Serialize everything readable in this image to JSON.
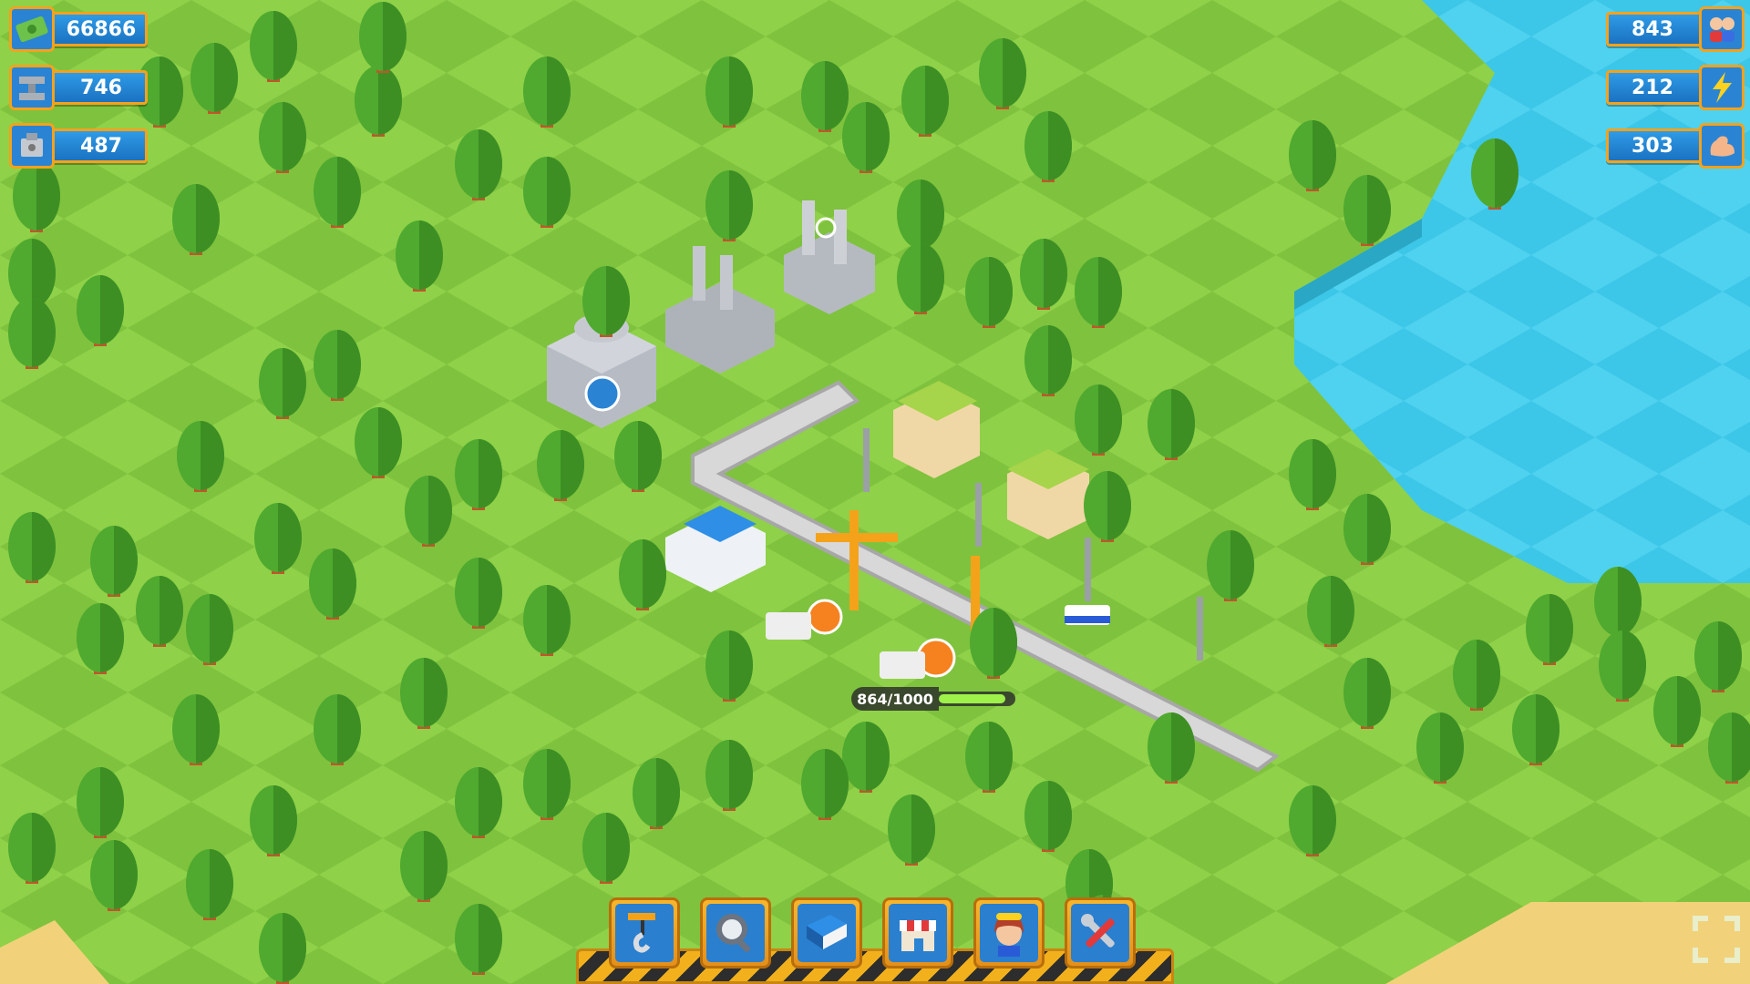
{
  "resources": {
    "money": {
      "value": "66866",
      "icon": "money-icon"
    },
    "steel": {
      "value": "746",
      "icon": "steel-icon"
    },
    "machines": {
      "value": "487",
      "icon": "machine-icon"
    },
    "population": {
      "value": "843",
      "icon": "people-icon"
    },
    "energy": {
      "value": "212",
      "icon": "lightning-icon"
    },
    "workforce": {
      "value": "303",
      "icon": "muscle-icon"
    }
  },
  "construction": {
    "progress_text": "864/1000",
    "progress": 0.864
  },
  "toolbar": {
    "buttons": [
      {
        "name": "build-crane-button",
        "icon": "crane-hook-icon"
      },
      {
        "name": "search-button",
        "icon": "magnifier-icon"
      },
      {
        "name": "book-button",
        "icon": "book-icon"
      },
      {
        "name": "shop-button",
        "icon": "shop-icon"
      },
      {
        "name": "advisor-button",
        "icon": "advisor-avatar-icon"
      },
      {
        "name": "tools-button",
        "icon": "wrench-screwdriver-icon"
      }
    ]
  },
  "colors": {
    "grass": "#8fd148",
    "grass_dark": "#7cbf3a",
    "water": "#3cc6e8",
    "badge": "#2a84d3",
    "frame": "#f5a21b"
  }
}
